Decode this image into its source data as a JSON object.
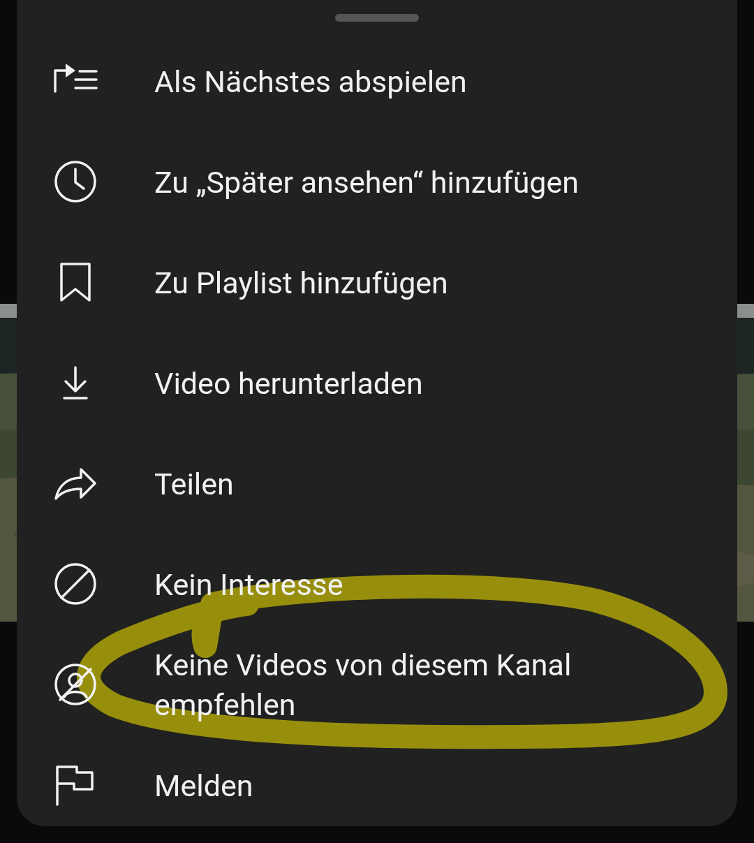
{
  "menu": {
    "items": [
      {
        "label": "Als Nächstes abspielen"
      },
      {
        "label": "Zu „Später ansehen“ hinzufügen"
      },
      {
        "label": "Zu Playlist hinzufügen"
      },
      {
        "label": "Video herunterladen"
      },
      {
        "label": "Teilen"
      },
      {
        "label": "Kein Interesse"
      },
      {
        "label": "Keine Videos von diesem Kanal empfehlen"
      },
      {
        "label": "Melden"
      }
    ]
  },
  "annotation": {
    "color": "#978f0c"
  }
}
